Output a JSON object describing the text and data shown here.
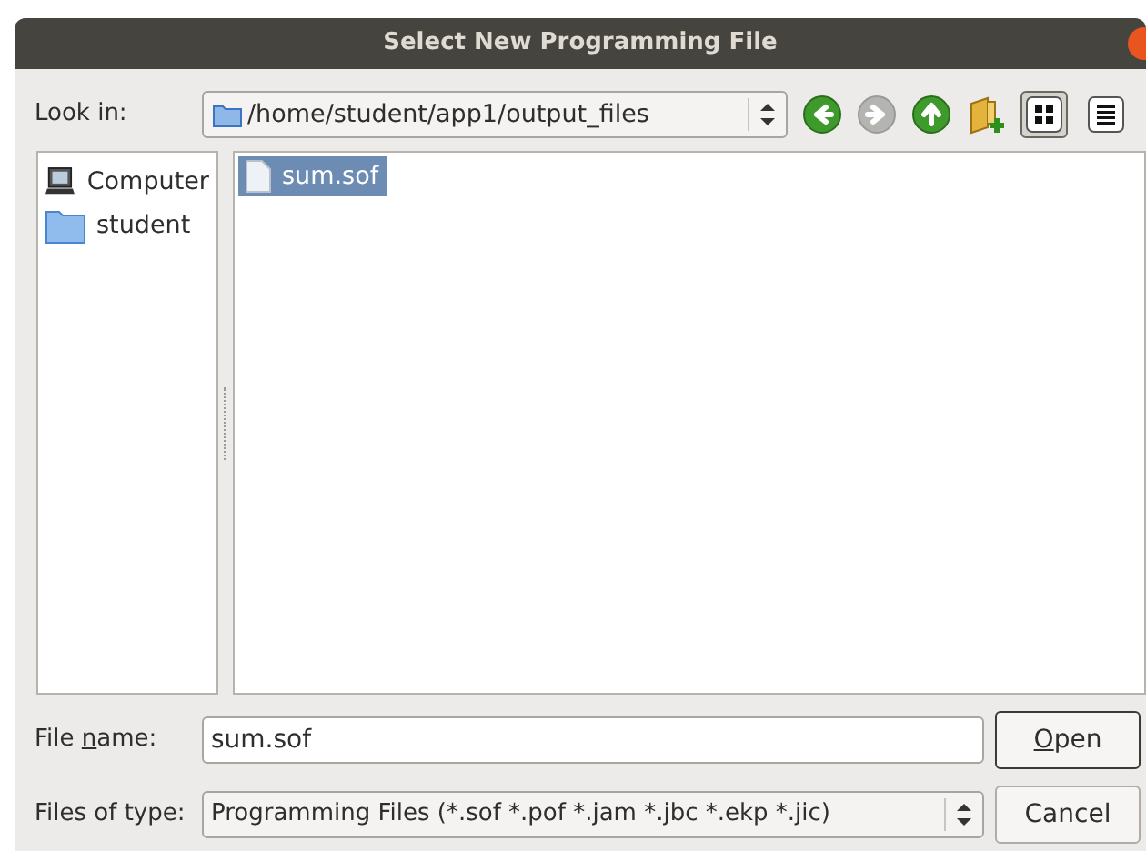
{
  "window": {
    "title": "Select New Programming File"
  },
  "look_in": {
    "label": "Look in:",
    "path": "/home/student/app1/output_files"
  },
  "toolbar": [
    {
      "kind": "back",
      "disabled": false
    },
    {
      "kind": "forward",
      "disabled": true
    },
    {
      "kind": "up",
      "disabled": false
    },
    {
      "kind": "new_folder"
    },
    {
      "kind": "icon_view",
      "selected": true
    },
    {
      "kind": "detail_view",
      "selected": false
    }
  ],
  "places": [
    {
      "kind": "computer",
      "label": "Computer"
    },
    {
      "kind": "folder",
      "label": "student"
    }
  ],
  "files": [
    {
      "name": "sum.sof",
      "selected": true
    }
  ],
  "file_name": {
    "label": {
      "before": "File ",
      "key": "n",
      "after": "ame:"
    },
    "value": "sum.sof"
  },
  "file_type": {
    "label": "Files of type:",
    "value": "Programming Files (*.sof *.pof *.jam *.jbc *.ekp *.jic)"
  },
  "buttons": [
    {
      "label": {
        "key": "O",
        "after": "pen"
      },
      "default": true
    },
    {
      "label": {
        "after": "Cancel"
      },
      "default": false
    }
  ]
}
